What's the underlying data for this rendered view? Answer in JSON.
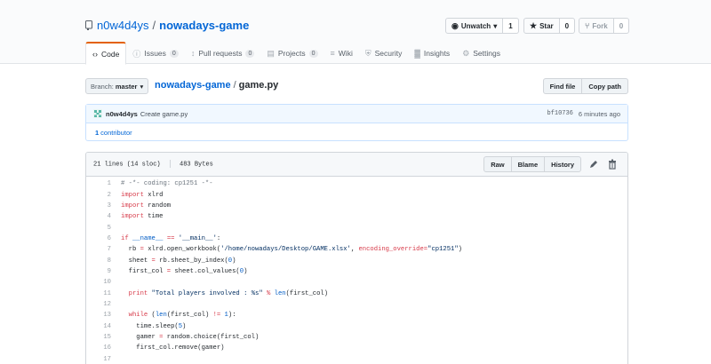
{
  "repo": {
    "owner": "n0w4d4ys",
    "separator": "/",
    "name": "nowadays-game"
  },
  "actions": [
    {
      "icon": "eye-icon",
      "glyph": "◉",
      "label": "Unwatch",
      "caret": "▾",
      "count": "1"
    },
    {
      "icon": "star-icon",
      "glyph": "★",
      "label": "Star",
      "count": "0"
    },
    {
      "icon": "fork-icon",
      "glyph": "⑂",
      "label": "Fork",
      "count": "0"
    }
  ],
  "tabs": [
    {
      "label": "Code",
      "icon": "code-icon",
      "glyph": "‹›"
    },
    {
      "label": "Issues",
      "icon": "issue-icon",
      "glyph": "ⓘ",
      "count": "0"
    },
    {
      "label": "Pull requests",
      "icon": "pull-request-icon",
      "glyph": "↕",
      "count": "0"
    },
    {
      "label": "Projects",
      "icon": "project-icon",
      "glyph": "▤",
      "count": "0"
    },
    {
      "label": "Wiki",
      "icon": "wiki-icon",
      "glyph": "≡"
    },
    {
      "label": "Security",
      "icon": "shield-icon",
      "glyph": "⛨"
    },
    {
      "label": "Insights",
      "icon": "graph-icon",
      "glyph": "▓"
    },
    {
      "label": "Settings",
      "icon": "gear-icon",
      "glyph": "⚙"
    }
  ],
  "branch": {
    "label": "Branch:",
    "value": "master",
    "caret": "▾"
  },
  "path": {
    "repo": "nowadays-game",
    "sep": "/",
    "file": "game.py"
  },
  "file_nav": {
    "find_file": "Find file",
    "copy_path": "Copy path"
  },
  "commit": {
    "author": "n0w4d4ys",
    "message": "Create game.py",
    "sha": "bf10736",
    "time": "6 minutes ago",
    "contributors_count": "1",
    "contributors_label": "contributor"
  },
  "file": {
    "lines_info": "21 lines (14 sloc)",
    "size": "483 Bytes",
    "raw": "Raw",
    "blame": "Blame",
    "history": "History",
    "edit_icon": "pencil-icon",
    "delete_icon": "trash-icon"
  },
  "code_lines": [
    {
      "n": "1",
      "t": [
        [
          "c",
          "# -*- coding: cp1251 -*-"
        ]
      ]
    },
    {
      "n": "2",
      "t": [
        [
          "k",
          "import"
        ],
        [
          "",
          " xlrd"
        ]
      ]
    },
    {
      "n": "3",
      "t": [
        [
          "k",
          "import"
        ],
        [
          "",
          " random"
        ]
      ]
    },
    {
      "n": "4",
      "t": [
        [
          "k",
          "import"
        ],
        [
          "",
          " time"
        ]
      ]
    },
    {
      "n": "5",
      "t": []
    },
    {
      "n": "6",
      "t": [
        [
          "k",
          "if"
        ],
        [
          "",
          " "
        ],
        [
          "n",
          "__name__"
        ],
        [
          "",
          " "
        ],
        [
          "k",
          "=="
        ],
        [
          "",
          " "
        ],
        [
          "s",
          "'__main__'"
        ],
        [
          "",
          ":"
        ]
      ]
    },
    {
      "n": "7",
      "t": [
        [
          "",
          "  rb "
        ],
        [
          "k",
          "="
        ],
        [
          "",
          " xlrd.open_workbook("
        ],
        [
          "s",
          "'/home/nowadays/Desktop/GAME.xlsx'"
        ],
        [
          "",
          ", "
        ],
        [
          "k",
          "encoding_override"
        ],
        [
          "k",
          "="
        ],
        [
          "s",
          "\"cp1251\""
        ],
        [
          "",
          ")"
        ]
      ]
    },
    {
      "n": "8",
      "t": [
        [
          "",
          "  sheet "
        ],
        [
          "k",
          "="
        ],
        [
          "",
          " rb.sheet_by_index("
        ],
        [
          "n",
          "0"
        ],
        [
          "",
          ")"
        ]
      ]
    },
    {
      "n": "9",
      "t": [
        [
          "",
          "  first_col "
        ],
        [
          "k",
          "="
        ],
        [
          "",
          " sheet.col_values("
        ],
        [
          "n",
          "0"
        ],
        [
          "",
          ")"
        ]
      ]
    },
    {
      "n": "10",
      "t": []
    },
    {
      "n": "11",
      "t": [
        [
          "",
          "  "
        ],
        [
          "k",
          "print"
        ],
        [
          "",
          " "
        ],
        [
          "s",
          "\"Total players involved : %s\""
        ],
        [
          "",
          " "
        ],
        [
          "k",
          "%"
        ],
        [
          "",
          " "
        ],
        [
          "n",
          "len"
        ],
        [
          "",
          "(first_col)"
        ]
      ]
    },
    {
      "n": "12",
      "t": []
    },
    {
      "n": "13",
      "t": [
        [
          "",
          "  "
        ],
        [
          "k",
          "while"
        ],
        [
          "",
          " ("
        ],
        [
          "n",
          "len"
        ],
        [
          "",
          "(first_col) "
        ],
        [
          "k",
          "!="
        ],
        [
          "",
          " "
        ],
        [
          "n",
          "1"
        ],
        [
          "",
          "):"
        ]
      ]
    },
    {
      "n": "14",
      "t": [
        [
          "",
          "    time.sleep("
        ],
        [
          "n",
          "5"
        ],
        [
          "",
          ")"
        ]
      ]
    },
    {
      "n": "15",
      "t": [
        [
          "",
          "    gamer "
        ],
        [
          "k",
          "="
        ],
        [
          "",
          " random.choice(first_col)"
        ]
      ]
    },
    {
      "n": "16",
      "t": [
        [
          "",
          "    first_col.remove(gamer)"
        ]
      ]
    },
    {
      "n": "17",
      "t": []
    }
  ],
  "colors": {
    "link": "#0366d6",
    "tab_accent": "#e36209",
    "commit_bg": "#f1f8ff"
  }
}
